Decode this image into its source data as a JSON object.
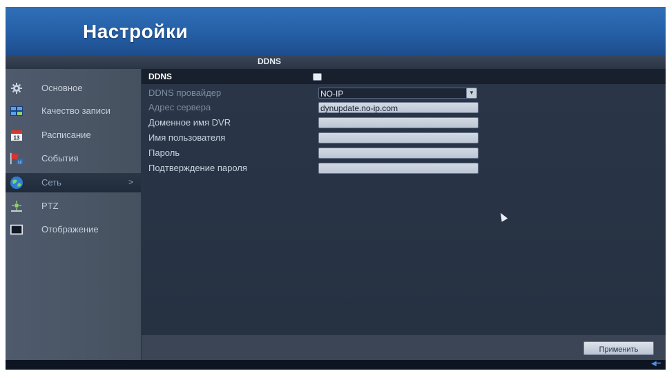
{
  "header": {
    "title": "Настройки"
  },
  "section": {
    "title": "DDNS"
  },
  "sidebar": {
    "items": [
      {
        "label": "Основное",
        "icon": "gear-icon"
      },
      {
        "label": "Качество записи",
        "icon": "grid-icon"
      },
      {
        "label": "Расписание",
        "icon": "calendar-icon"
      },
      {
        "label": "События",
        "icon": "event-flag-icon"
      },
      {
        "label": "Сеть",
        "icon": "globe-icon",
        "active": true,
        "arrow": ">"
      },
      {
        "label": "PTZ",
        "icon": "ptz-camera-icon"
      },
      {
        "label": "Отображение",
        "icon": "monitor-icon"
      }
    ]
  },
  "form": {
    "ddns_label": "DDNS",
    "ddns_enabled": true,
    "fields": [
      {
        "label": "DDNS провайдер",
        "value": "NO-IP",
        "type": "select"
      },
      {
        "label": "Адрес сервера",
        "value": "dynupdate.no-ip.com",
        "type": "text"
      },
      {
        "label": "Доменное имя DVR",
        "value": "",
        "type": "text"
      },
      {
        "label": "Имя пользователя",
        "value": "",
        "type": "text"
      },
      {
        "label": "Пароль",
        "value": "",
        "type": "password"
      },
      {
        "label": "Подтверждение пароля",
        "value": "",
        "type": "password"
      }
    ]
  },
  "footer": {
    "apply_label": "Применить"
  },
  "colors": {
    "header": "#2a67b1",
    "panel": "#263142",
    "sidebar": "#4b5769"
  }
}
